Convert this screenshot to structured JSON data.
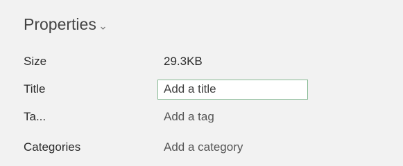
{
  "properties": {
    "header": "Properties",
    "rows": [
      {
        "label": "Size",
        "value": "29.3KB"
      },
      {
        "label": "Title",
        "value": "Add a title"
      },
      {
        "label": "Ta...",
        "value": "Add a tag"
      },
      {
        "label": "Categories",
        "value": "Add a category"
      }
    ]
  },
  "icons": {
    "header_caret": "chevron-down-icon"
  },
  "colors": {
    "background": "#f2f2f2",
    "active_border": "#86b993"
  }
}
